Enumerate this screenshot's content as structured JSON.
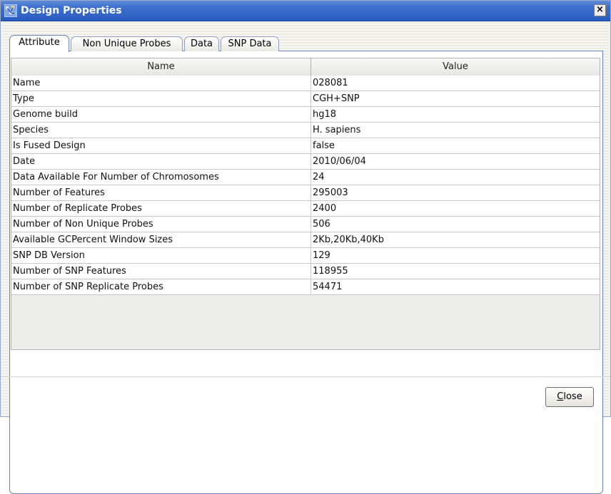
{
  "window": {
    "title": "Design Properties",
    "close_glyph": "×"
  },
  "tabs": [
    {
      "label": "Attribute",
      "active": true
    },
    {
      "label": "Non Unique Probes",
      "active": false
    },
    {
      "label": "Data",
      "active": false
    },
    {
      "label": "SNP Data",
      "active": false
    }
  ],
  "table": {
    "columns": [
      "Name",
      "Value"
    ],
    "rows": [
      [
        "Name",
        "028081"
      ],
      [
        "Type",
        "CGH+SNP"
      ],
      [
        "Genome build",
        "hg18"
      ],
      [
        "Species",
        "H. sapiens"
      ],
      [
        "Is Fused Design",
        "false"
      ],
      [
        "Date",
        "2010/06/04"
      ],
      [
        "Data Available For Number of Chromosomes",
        "24"
      ],
      [
        "Number of Features",
        "295003"
      ],
      [
        "Number of Replicate Probes",
        "2400"
      ],
      [
        "Number of Non Unique Probes",
        "506"
      ],
      [
        "Available GCPercent Window Sizes",
        "2Kb,20Kb,40Kb"
      ],
      [
        "SNP DB Version",
        "129"
      ],
      [
        "Number of SNP Features",
        "118955"
      ],
      [
        "Number of SNP Replicate Probes",
        "54471"
      ]
    ]
  },
  "footer": {
    "close_label_mnemonic": "C",
    "close_label_rest": "lose"
  },
  "colors": {
    "titlebar": "#2a5cbf",
    "tab_border": "#6b82b8"
  },
  "icons": {
    "title_icon": "design-properties-icon",
    "close": "close-icon"
  }
}
